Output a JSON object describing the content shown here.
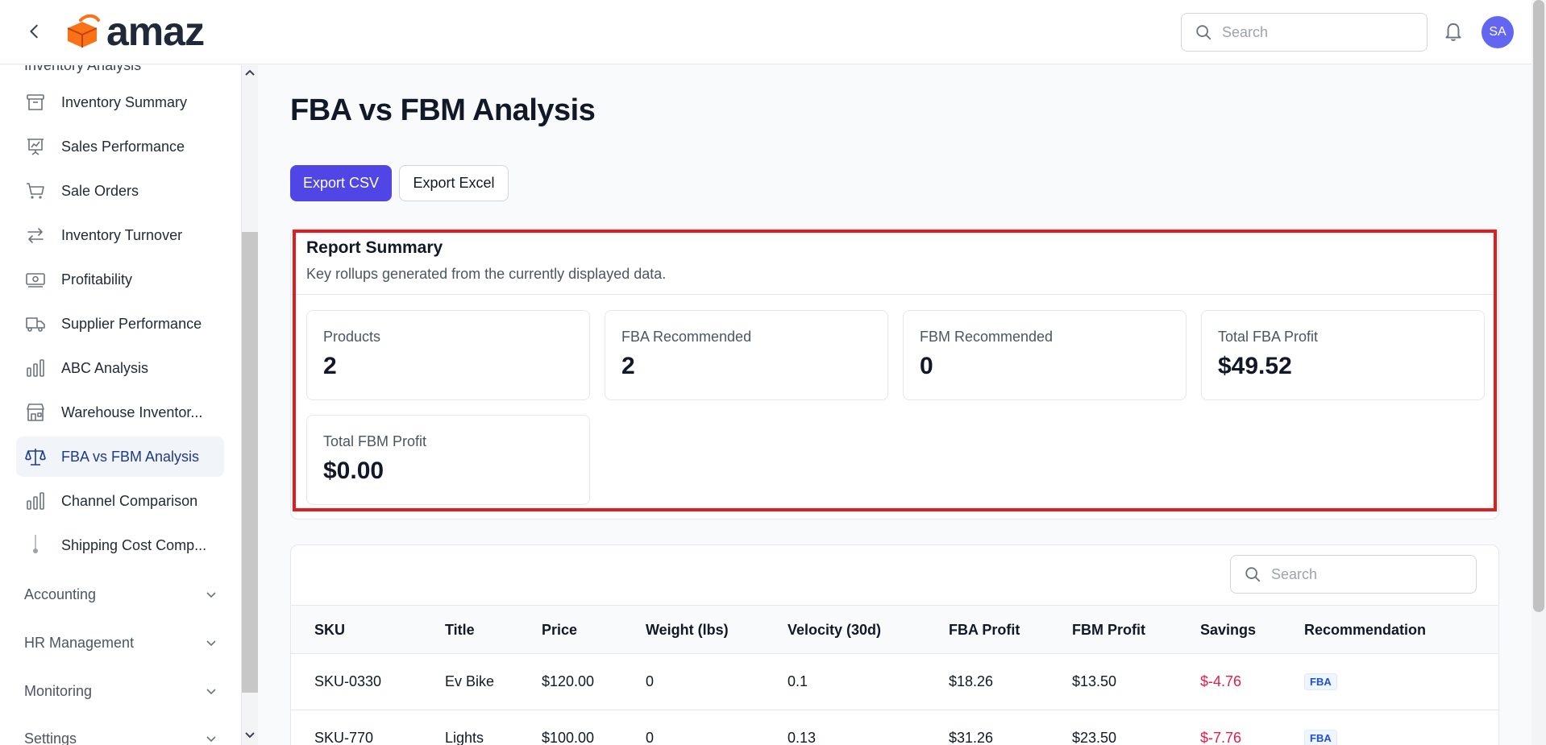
{
  "header": {
    "logo_text": "amaz",
    "search_placeholder": "Search",
    "avatar_initials": "SA"
  },
  "sidebar": {
    "partial_top": "Inventory Analysis",
    "items": [
      {
        "label": "Inventory Summary",
        "icon": "archive-box-icon"
      },
      {
        "label": "Sales Performance",
        "icon": "presentation-chart-icon"
      },
      {
        "label": "Sale Orders",
        "icon": "shopping-cart-icon"
      },
      {
        "label": "Inventory Turnover",
        "icon": "arrows-right-left-icon"
      },
      {
        "label": "Profitability",
        "icon": "banknotes-icon"
      },
      {
        "label": "Supplier Performance",
        "icon": "truck-icon"
      },
      {
        "label": "ABC Analysis",
        "icon": "bar-chart-icon"
      },
      {
        "label": "Warehouse Inventor...",
        "icon": "building-storefront-icon"
      },
      {
        "label": "FBA vs FBM Analysis",
        "icon": "scale-icon",
        "active": true
      },
      {
        "label": "Channel Comparison",
        "icon": "bar-chart-icon"
      },
      {
        "label": "Shipping Cost Comp...",
        "icon": "tree-dot-icon"
      }
    ],
    "sections": [
      {
        "label": "Accounting"
      },
      {
        "label": "HR Management"
      },
      {
        "label": "Monitoring"
      },
      {
        "label": "Settings"
      }
    ]
  },
  "main": {
    "title": "FBA vs FBM Analysis",
    "export_csv": "Export CSV",
    "export_excel": "Export Excel",
    "summary": {
      "title": "Report Summary",
      "subtitle": "Key rollups generated from the currently displayed data.",
      "stats": [
        {
          "label": "Products",
          "value": "2"
        },
        {
          "label": "FBA Recommended",
          "value": "2"
        },
        {
          "label": "FBM Recommended",
          "value": "0"
        },
        {
          "label": "Total FBA Profit",
          "value": "$49.52"
        },
        {
          "label": "Total FBM Profit",
          "value": "$0.00"
        }
      ]
    },
    "table": {
      "search_placeholder": "Search",
      "columns": [
        "SKU",
        "Title",
        "Price",
        "Weight (lbs)",
        "Velocity (30d)",
        "FBA Profit",
        "FBM Profit",
        "Savings",
        "Recommendation"
      ],
      "rows": [
        [
          "SKU-0330",
          "Ev Bike",
          "$120.00",
          "0",
          "0.1",
          "$18.26",
          "$13.50",
          "$-4.76",
          "FBA"
        ],
        [
          "SKU-770",
          "Lights",
          "$100.00",
          "0",
          "0.13",
          "$31.26",
          "$23.50",
          "$-7.76",
          "FBA"
        ]
      ]
    }
  }
}
